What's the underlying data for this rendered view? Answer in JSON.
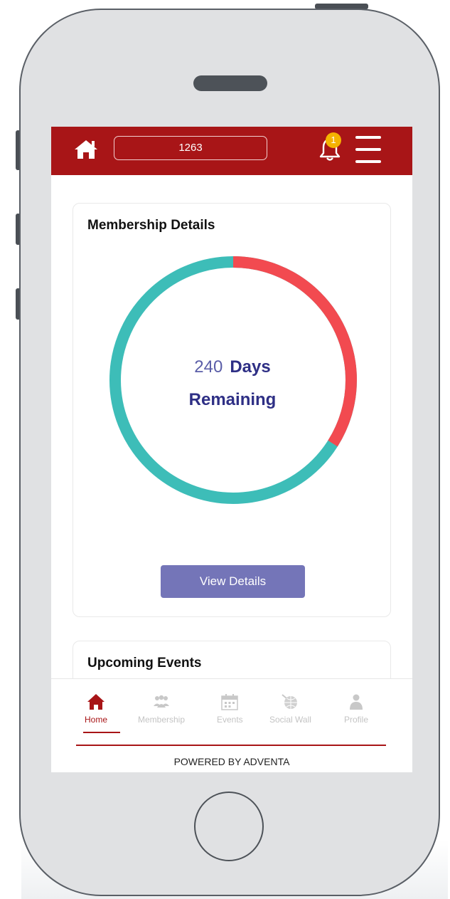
{
  "topbar": {
    "member_id": "1263",
    "notification_count": "1",
    "bg_color": "#a81517",
    "icons": [
      "home-icon",
      "bell-icon",
      "menu-icon"
    ]
  },
  "membership_card": {
    "title": "Membership Details",
    "days_value": "240",
    "days_label": "Days",
    "remaining_label": "Remaining",
    "remaining_fraction": 0.66,
    "remaining_color": "#3dbdb8",
    "elapsed_color": "#f24a50",
    "button_label": "View Details"
  },
  "events_card": {
    "title": "Upcoming Events"
  },
  "bottom_nav": {
    "items": [
      {
        "label": "Home",
        "icon": "home-icon",
        "active": true
      },
      {
        "label": "Membership",
        "icon": "people-icon",
        "active": false
      },
      {
        "label": "Events",
        "icon": "calendar-icon",
        "active": false
      },
      {
        "label": "Social Wall",
        "icon": "globe-icon",
        "active": false
      },
      {
        "label": "Profile",
        "icon": "person-icon",
        "active": false
      }
    ],
    "footer": "POWERED BY ADVENTA"
  }
}
